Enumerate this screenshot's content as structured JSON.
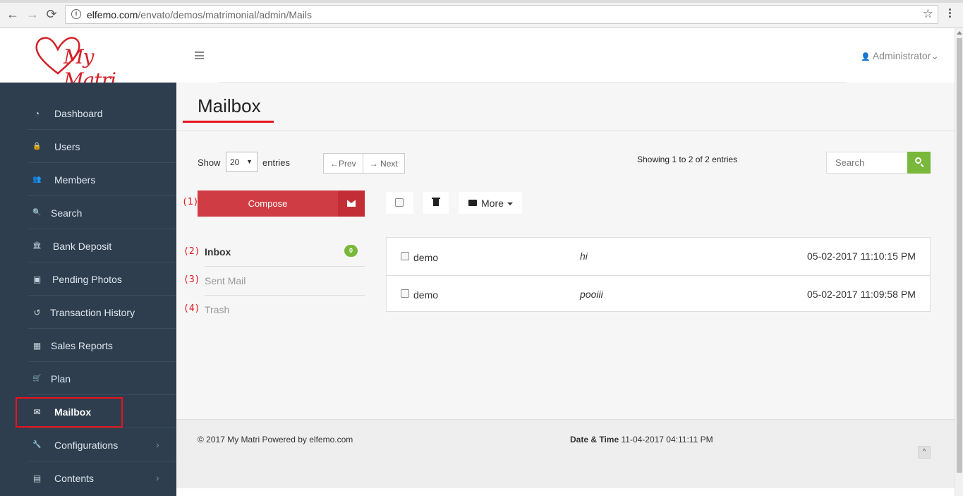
{
  "browser": {
    "url_host": "elfemo.com",
    "url_path": "/envato/demos/matrimonial/admin/Mails",
    "back": "←",
    "forward": "→",
    "reload": "⟳",
    "info": "i",
    "star": "☆"
  },
  "header": {
    "logo_text": "My Matri",
    "admin_label": "Administrator",
    "admin_icon": "👤",
    "admin_chevron": "⌄"
  },
  "sidebar": {
    "items": [
      {
        "label": "Dashboard",
        "icon": "dashboard-icon",
        "glyph": "◔"
      },
      {
        "label": "Users",
        "icon": "user-lock-icon",
        "glyph": "🔒"
      },
      {
        "label": "Members",
        "icon": "members-icon",
        "glyph": "👥"
      },
      {
        "label": "Search",
        "icon": "search-icon",
        "glyph": "🔍"
      },
      {
        "label": "Bank Deposit",
        "icon": "bank-icon",
        "glyph": "🏛"
      },
      {
        "label": "Pending Photos",
        "icon": "photo-icon",
        "glyph": "▣"
      },
      {
        "label": "Transaction History",
        "icon": "history-icon",
        "glyph": "↺"
      },
      {
        "label": "Sales Reports",
        "icon": "table-icon",
        "glyph": "▦"
      },
      {
        "label": "Plan",
        "icon": "cart-icon",
        "glyph": "🛒"
      },
      {
        "label": "Mailbox",
        "icon": "envelope-icon",
        "glyph": "✉"
      },
      {
        "label": "Configurations",
        "icon": "wrench-icon",
        "glyph": "🔧"
      },
      {
        "label": "Contents",
        "icon": "contents-icon",
        "glyph": "▤"
      }
    ],
    "chevron": "›"
  },
  "main": {
    "title": "Mailbox",
    "show_label": "Show",
    "entries_value": "20",
    "entries_label": "entries",
    "prev_label": "←Prev",
    "next_label": "→ Next",
    "showing_text": "Showing 1 to 2 of 2 entries",
    "search_placeholder": "Search",
    "compose_label": "Compose",
    "more_label": "More",
    "markers": [
      "(1)",
      "(2)",
      "(3)",
      "(4)"
    ],
    "folders": [
      {
        "label": "Inbox",
        "badge": "0"
      },
      {
        "label": "Sent Mail"
      },
      {
        "label": "Trash"
      }
    ],
    "mails": [
      {
        "from": "demo",
        "subject": "hi",
        "date": "05-02-2017 11:10:15 PM"
      },
      {
        "from": "demo",
        "subject": "pooiii",
        "date": "05-02-2017 11:09:58 PM"
      }
    ]
  },
  "footer": {
    "copyright": "© 2017 My Matri Powered by elfemo.com",
    "datetime_label": "Date & Time",
    "datetime_value": "11-04-2017 04:11:11 PM",
    "to_top": "^"
  },
  "colors": {
    "sidebar_bg": "#2e3e4e",
    "accent_red": "#d03c43",
    "highlight_red": "#e8141c",
    "success_green": "#7ab83b"
  }
}
